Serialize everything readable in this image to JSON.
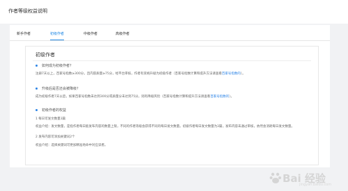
{
  "header": {
    "title": "作者等级权益说明"
  },
  "tabs": [
    {
      "label": "新手作者"
    },
    {
      "label": "初级作者"
    },
    {
      "label": "中级作者"
    },
    {
      "label": "高级作者"
    }
  ],
  "panel": {
    "title": "初级作者",
    "q1": "如何成为初级作者？",
    "p1_before": "注册7天以上，百家号指数≥300分，且内容质量≥75分，经平台审核，作者有资格升级为初级作者（百家号指数计算和提升方法请查看",
    "p1_link": "百家号指数的",
    "p1_after": "）。",
    "q2": "升级后是否还会被降级？",
    "p2_before": "成为初级作者7天以后，如果百家号指数未达到300分或质量分未达到75分，则有降级风险（百家号指数计算和提升方法请查看",
    "p2_link": "百家号指数的",
    "p2_after": "）。",
    "q3": "初级作者的权益",
    "r1": "1 每日可发文数量3篇",
    "r1_desc": "权益介绍：发文数量，是指作者每日能发布内容的数量上限，不同的作者等级会获得不同的每日发文数量。初级作者每日发文数量为3篇，发布内容未通过审核，依然会消耗每日发文数量。",
    "r2": "2 发布内容可添加关键词2个",
    "r2_desc": "权益介绍：选择关键词可更加精准地命中对应读者。"
  },
  "watermark": {
    "brand": "Bai 经验",
    "url": "jingyan.baidu.com"
  }
}
